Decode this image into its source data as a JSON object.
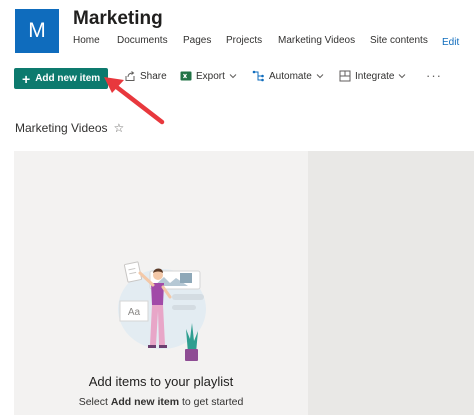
{
  "site": {
    "logo_letter": "M",
    "title": "Marketing",
    "nav": [
      "Home",
      "Documents",
      "Pages",
      "Projects",
      "Marketing Videos",
      "Site contents"
    ],
    "edit": "Edit"
  },
  "commands": {
    "add_new_item": "Add new item",
    "share": "Share",
    "export": "Export",
    "automate": "Automate",
    "integrate": "Integrate",
    "more": "···"
  },
  "list": {
    "title": "Marketing Videos",
    "star": "☆"
  },
  "empty_state": {
    "heading": "Add items to your playlist",
    "sub_before": "Select",
    "sub_bold": "Add new item",
    "sub_after": "to get started",
    "illustration_card_text": "Aa"
  },
  "colors": {
    "brand": "#0f6cbd",
    "primary_button": "#0d7a6e",
    "annotation_arrow": "#e8383d",
    "excel_green": "#217346"
  }
}
